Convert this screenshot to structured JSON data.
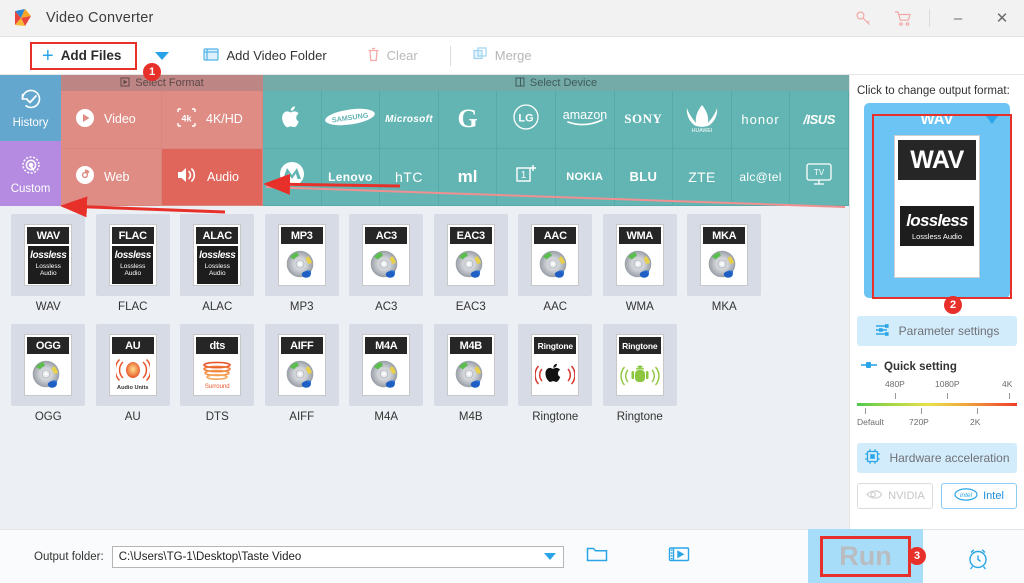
{
  "window": {
    "title": "Video Converter",
    "logo_icon": "app-logo-play-icon",
    "key_icon": "key-icon",
    "cart_icon": "cart-icon",
    "minimize": "–",
    "close": "✕"
  },
  "toolbar": {
    "add_files": "Add Files",
    "add_files_icon": "plus-icon",
    "dropdown_icon": "chevron-down-icon",
    "add_video_folder": "Add Video Folder",
    "add_video_folder_icon": "folder-video-icon",
    "clear": "Clear",
    "clear_icon": "trash-icon",
    "merge": "Merge",
    "merge_icon": "merge-icon"
  },
  "sidebar": {
    "items": [
      {
        "label": "History",
        "icon": "history-clock-icon",
        "color": "#63a7cf"
      },
      {
        "label": "Custom",
        "icon": "gear-icon",
        "color": "#b48be0"
      }
    ]
  },
  "format_panel": {
    "header": "Select Format",
    "header_icon": "format-icon",
    "categories": [
      {
        "label": "Video",
        "icon": "play-circle-icon",
        "active": false
      },
      {
        "label": "4K/HD",
        "icon": "4k-icon",
        "active": false
      },
      {
        "label": "Web",
        "icon": "chrome-icon",
        "active": false
      },
      {
        "label": "Audio",
        "icon": "speaker-icon",
        "active": true
      }
    ]
  },
  "device_panel": {
    "header": "Select Device",
    "header_icon": "device-icon",
    "brands": [
      {
        "name": "Apple",
        "icon": "apple-logo-icon"
      },
      {
        "name": "SAMSUNG",
        "icon": "samsung-logo-icon"
      },
      {
        "name": "Microsoft",
        "icon": "microsoft-logo-icon"
      },
      {
        "name": "G",
        "icon": "google-logo-icon"
      },
      {
        "name": "LG",
        "icon": "lg-logo-icon"
      },
      {
        "name": "amazon",
        "icon": "amazon-logo-icon"
      },
      {
        "name": "SONY",
        "icon": "sony-logo-icon"
      },
      {
        "name": "HUAWEI",
        "icon": "huawei-logo-icon"
      },
      {
        "name": "honor",
        "icon": "honor-logo-icon"
      },
      {
        "name": "ASUS",
        "icon": "asus-logo-icon"
      },
      {
        "name": "Motorola",
        "icon": "motorola-logo-icon"
      },
      {
        "name": "Lenovo",
        "icon": "lenovo-logo-icon"
      },
      {
        "name": "HTC",
        "icon": "htc-logo-icon"
      },
      {
        "name": "MI",
        "icon": "xiaomi-logo-icon"
      },
      {
        "name": "OnePlus",
        "icon": "oneplus-logo-icon"
      },
      {
        "name": "NOKIA",
        "icon": "nokia-logo-icon"
      },
      {
        "name": "BLU",
        "icon": "blu-logo-icon"
      },
      {
        "name": "ZTE",
        "icon": "zte-logo-icon"
      },
      {
        "name": "alcatel",
        "icon": "alcatel-logo-icon"
      },
      {
        "name": "TV",
        "icon": "tv-icon"
      }
    ]
  },
  "formats": [
    {
      "label": "WAV",
      "cap": "WAV",
      "art": "lossless",
      "selected": true
    },
    {
      "label": "FLAC",
      "cap": "FLAC",
      "art": "lossless",
      "selected": false
    },
    {
      "label": "ALAC",
      "cap": "ALAC",
      "art": "lossless",
      "selected": false
    },
    {
      "label": "MP3",
      "cap": "MP3",
      "art": "disc",
      "selected": false
    },
    {
      "label": "AC3",
      "cap": "AC3",
      "art": "disc",
      "selected": false
    },
    {
      "label": "EAC3",
      "cap": "EAC3",
      "art": "disc",
      "selected": false
    },
    {
      "label": "AAC",
      "cap": "AAC",
      "art": "disc",
      "selected": false
    },
    {
      "label": "WMA",
      "cap": "WMA",
      "art": "disc",
      "selected": false
    },
    {
      "label": "MKA",
      "cap": "MKA",
      "art": "disc",
      "selected": false
    },
    {
      "label": "OGG",
      "cap": "OGG",
      "art": "disc",
      "selected": false
    },
    {
      "label": "AU",
      "cap": "AU",
      "art": "audiounits",
      "selected": false
    },
    {
      "label": "DTS",
      "cap": "dts",
      "art": "dts",
      "selected": false
    },
    {
      "label": "AIFF",
      "cap": "AIFF",
      "art": "disc",
      "selected": false
    },
    {
      "label": "M4A",
      "cap": "M4A",
      "art": "disc",
      "selected": false
    },
    {
      "label": "M4B",
      "cap": "M4B",
      "art": "disc",
      "selected": false
    },
    {
      "label": "Ringtone",
      "cap": "Ringtone",
      "art": "apple-ring",
      "selected": false
    },
    {
      "label": "Ringtone",
      "cap": "Ringtone",
      "art": "android-ring",
      "selected": false
    }
  ],
  "format_art_text": {
    "lossless_word": "lossless",
    "lossless_line2": "Lossless",
    "lossless_line3": "Audio",
    "audio_units": "Audio Units",
    "dts_surround": "Surround"
  },
  "right_panel": {
    "hint": "Click to change output format:",
    "output_format": "WAV",
    "output_caret_icon": "chevron-down-icon",
    "preview_cap": "WAV",
    "preview_word": "lossless",
    "preview_sub": "Lossless Audio",
    "parameter_settings": "Parameter settings",
    "parameter_icon": "sliders-icon",
    "quick_setting": "Quick setting",
    "quick_icon": "slider-handle-icon",
    "quality_top": [
      "480P",
      "1080P",
      "4K"
    ],
    "quality_bottom": [
      "Default",
      "720P",
      "2K"
    ],
    "hardware_acceleration": "Hardware acceleration",
    "hardware_icon": "cpu-icon",
    "accel_options": [
      {
        "label": "NVIDIA",
        "icon": "nvidia-logo-icon",
        "enabled": false
      },
      {
        "label": "Intel",
        "icon": "intel-logo-icon",
        "enabled": true
      }
    ]
  },
  "bottom": {
    "output_folder_label": "Output folder:",
    "output_folder_value": "C:\\Users\\TG-1\\Desktop\\Taste Video",
    "folder_icon": "folder-open-icon",
    "media_icon": "film-icon",
    "run_label": "Run",
    "alarm_icon": "alarm-clock-icon"
  },
  "annotations": {
    "badges": [
      "1",
      "2",
      "3"
    ],
    "accent_red": "#e8302a",
    "accent_blue": "#2aa6e8",
    "selected_outline": "#2330d8"
  }
}
